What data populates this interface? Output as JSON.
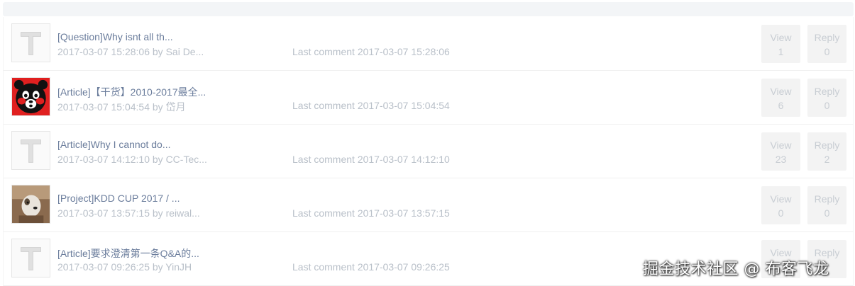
{
  "topics": [
    {
      "title": "[Question]Why isnt all th...",
      "meta": "2017-03-07 15:28:06 by Sai De...",
      "last_comment": "Last comment 2017-03-07 15:28:06",
      "view_label": "View",
      "view_count": "1",
      "reply_label": "Reply",
      "reply_count": "0",
      "avatar": "default-t"
    },
    {
      "title": "[Article]【干货】2010-2017最全...",
      "meta": "2017-03-07 15:04:54 by 岱月",
      "last_comment": "Last comment 2017-03-07 15:04:54",
      "view_label": "View",
      "view_count": "6",
      "reply_label": "Reply",
      "reply_count": "0",
      "avatar": "bear"
    },
    {
      "title": "[Article]Why I cannot do...",
      "meta": "2017-03-07 14:12:10 by CC-Tec...",
      "last_comment": "Last comment 2017-03-07 14:12:10",
      "view_label": "View",
      "view_count": "23",
      "reply_label": "Reply",
      "reply_count": "2",
      "avatar": "default-t"
    },
    {
      "title": "[Project]KDD CUP 2017 / ...",
      "meta": "2017-03-07 13:57:15 by reiwal...",
      "last_comment": "Last comment 2017-03-07 13:57:15",
      "view_label": "View",
      "view_count": "0",
      "reply_label": "Reply",
      "reply_count": "0",
      "avatar": "photo"
    },
    {
      "title": "[Article]要求澄清第一条Q&A的...",
      "meta": "2017-03-07 09:26:25 by YinJH",
      "last_comment": "Last comment 2017-03-07 09:26:25",
      "view_label": "View",
      "view_count": "",
      "reply_label": "Reply",
      "reply_count": "",
      "avatar": "default-t"
    }
  ],
  "watermark": "掘金技术社区 @ 布客飞龙"
}
